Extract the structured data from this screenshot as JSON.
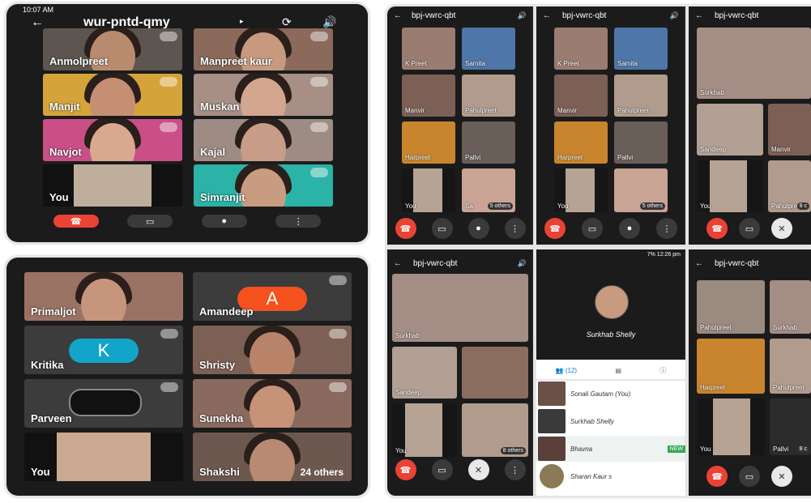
{
  "phone1": {
    "status_time": "10:07 AM",
    "meeting_code": "wur-pntd-qmy",
    "tiles": [
      {
        "name": "Anmolpreet"
      },
      {
        "name": "Manpreet kaur"
      },
      {
        "name": "Manjit"
      },
      {
        "name": "Muskan"
      },
      {
        "name": "Navjot"
      },
      {
        "name": "Kajal"
      },
      {
        "name": "You"
      },
      {
        "name": "Simranjit"
      }
    ]
  },
  "phone2": {
    "tiles": [
      {
        "name": "Primaljot"
      },
      {
        "name": "Amandeep",
        "avatar": "A"
      },
      {
        "name": "Kritika",
        "avatar": "K"
      },
      {
        "name": "Shristy"
      },
      {
        "name": "Parveen"
      },
      {
        "name": "Sunekha"
      },
      {
        "name": "You"
      },
      {
        "name": "Shakshi",
        "extra": "24 others"
      }
    ]
  },
  "meet": {
    "meeting_code": "bpj-vwrc-qbt",
    "p3": [
      "K Preet",
      "Samita",
      "Manvir",
      "Pahulpreet",
      "Harpreet",
      "Pallvi",
      "You",
      "Sa"
    ],
    "p3_others": "5 others",
    "p4": [
      "K Preet",
      "Samita",
      "Manvir",
      "Pahulpreet",
      "Harpreet",
      "Pallvi",
      "You",
      ""
    ],
    "p4_others": "5 others",
    "p5": [
      "Surkhab",
      "Sandeep",
      "Manvir",
      "You",
      "Pahulpreet"
    ],
    "p5_others": "8 c",
    "p6": [
      "Surkhab",
      "Sandeep",
      "",
      "You",
      ""
    ],
    "p6_others": "8 others",
    "p8": [
      "Pahulpreet",
      "Surkhab",
      "Harpreet",
      "Pahulpreet",
      "You",
      "Pallvi"
    ],
    "p8_others": "8 c",
    "p7": {
      "status": "7% 12:26 pm",
      "host_name": "Surkhab Shelly",
      "count": "(12)",
      "participants": [
        "Sonali Gautam (You)",
        "Surkhab Shelly",
        "Bhavna",
        "Sharan Kaur s"
      ],
      "new_badge": "NEW"
    }
  },
  "colors": {
    "end": "#ea4335",
    "bg": "#1b1b1b",
    "avatarA": "#f4511e",
    "avatarK": "#12a5c9"
  }
}
